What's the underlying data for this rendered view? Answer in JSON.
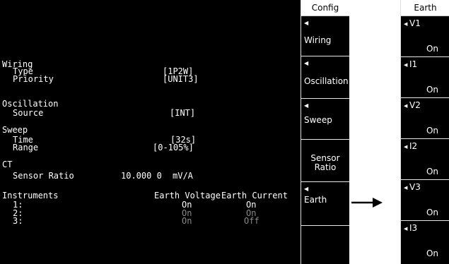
{
  "main": {
    "wiring": {
      "heading": "Wiring",
      "type_label": "Type",
      "type_value": "[1P2W]",
      "priority_label": "Priority",
      "priority_value": "[UNIT3]"
    },
    "oscillation": {
      "heading": "Oscillation",
      "source_label": "Source",
      "source_value": "[INT]"
    },
    "sweep": {
      "heading": "Sweep",
      "time_label": "Time",
      "time_value": "[32s]",
      "range_label": "Range",
      "range_value": "[0-105%]"
    },
    "ct": {
      "heading": "CT",
      "ratio_label": "Sensor Ratio",
      "ratio_value": "10.000 0",
      "ratio_unit": "mV/A"
    },
    "instruments": {
      "heading": "Instruments",
      "col_voltage": "Earth Voltage",
      "col_current": "Earth Current",
      "rows": [
        {
          "label": "1:",
          "voltage": "On",
          "current": "On",
          "dimmed": false
        },
        {
          "label": "2:",
          "voltage": "On",
          "current": "On",
          "dimmed": true
        },
        {
          "label": "3:",
          "voltage": "On",
          "current": "Off",
          "dimmed": true
        }
      ]
    }
  },
  "config_menu": {
    "title": "Config",
    "keys": [
      {
        "label": "Wiring"
      },
      {
        "label": "Oscillation"
      },
      {
        "label": "Sweep"
      },
      {
        "label_line1": "Sensor",
        "label_line2": "Ratio"
      },
      {
        "label": "Earth"
      }
    ]
  },
  "earth_menu": {
    "title": "Earth",
    "items": [
      {
        "name": "V1",
        "value": "On"
      },
      {
        "name": "I1",
        "value": "On"
      },
      {
        "name": "V2",
        "value": "On"
      },
      {
        "name": "I2",
        "value": "On"
      },
      {
        "name": "V3",
        "value": "On"
      },
      {
        "name": "I3",
        "value": "On"
      }
    ]
  },
  "colors": {
    "screen_bg": "#000000",
    "text": "#ffffff",
    "dimmed_text": "#8a8a8a",
    "menu_title_bg": "#ffffff"
  }
}
